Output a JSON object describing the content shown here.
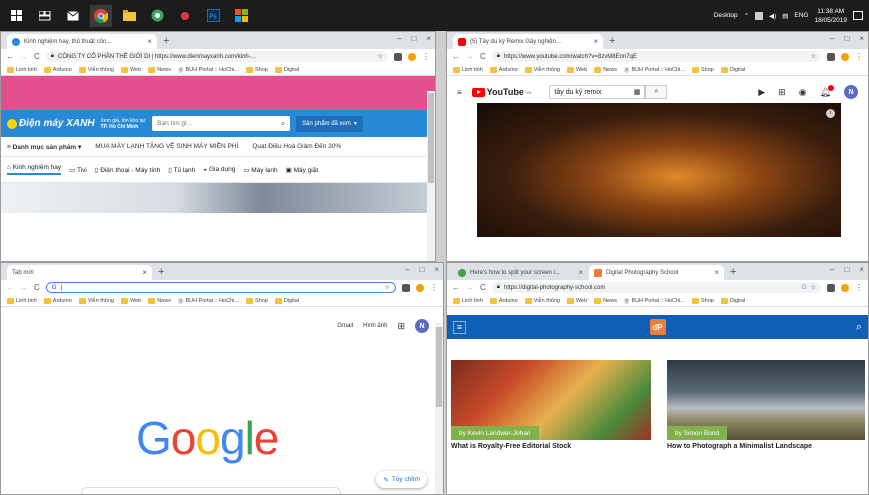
{
  "taskbar": {
    "icons": [
      "windows-logo-icon",
      "task-view-icon",
      "mail-icon",
      "chrome-icon",
      "file-explorer-icon",
      "green-app-icon",
      "red-app-icon",
      "photoshop-icon",
      "grid-app-icon"
    ],
    "desktop_label": "Desktop",
    "lang": "ENG",
    "time": "11:38 AM",
    "date": "18/05/2019"
  },
  "win1": {
    "tab_title": "Kinh nghiệm hay, thủ thuật côn...",
    "url": "CÔNG TY CỔ PHẦN THẾ GIỚI DI | https://www.dienmayxanh.com/kinh-...",
    "bookmarks": [
      "Linh tinh",
      "Arduino",
      "Viễn thông",
      "Web",
      "News",
      "BUH Portal :: HoChi...",
      "Shop",
      "Digital"
    ],
    "logo": "Điện máy XANH",
    "location_line1": "Xem giá, tồn kho tại:",
    "location_line2": "TP. Hồ Chí Minh",
    "search_placeholder": "Bạn tìm gì...",
    "cart_label": "Sản phẩm đã xem",
    "menu_label": "Danh mục sản phẩm",
    "promo1": "MUA MÁY LẠNH TẶNG VỆ SINH MÁY MIỄN PHÍ",
    "promo2": "Quạt Điều Hoà Giảm Đến 30%",
    "categories": [
      "Kinh nghiệm hay",
      "Tivi",
      "Điện thoại - Máy tính",
      "Tủ lạnh",
      "Gia dụng",
      "Máy lạnh",
      "Máy giặt"
    ]
  },
  "win2": {
    "tab_title": "(5) Tây du ký Remix Gây nghiện...",
    "url": "https://www.youtube.com/watch?v=8zvM8Enn7qE",
    "bookmarks": [
      "Linh tinh",
      "Arduino",
      "Viễn thông",
      "Web",
      "News",
      "BUH Portal :: HoChi...",
      "Shop",
      "Digital"
    ],
    "logo": "YouTube",
    "logo_region": "VN",
    "search_value": "tây du ký remix",
    "avatar": "N"
  },
  "win3": {
    "tab_title": "Tab mới",
    "url": "G",
    "bookmarks": [
      "Linh tinh",
      "Arduino",
      "Viễn thông",
      "Web",
      "News",
      "BUH Portal :: HoChi...",
      "Shop",
      "Digital"
    ],
    "gmail": "Gmail",
    "images": "Hình ảnh",
    "avatar": "N",
    "google_letters": [
      "G",
      "o",
      "o",
      "g",
      "l",
      "e"
    ],
    "google_colors": [
      "#4285f4",
      "#ea4335",
      "#fbbc05",
      "#4285f4",
      "#34a853",
      "#ea4335"
    ],
    "customize": "Tùy chỉnh"
  },
  "win4": {
    "tab1_title": "Here's how to split your screen i...",
    "tab2_title": "Digital Photography School",
    "url": "https://digital-photography-school.com",
    "bookmarks": [
      "Linh tinh",
      "Arduino",
      "Viễn thông",
      "Web",
      "News",
      "BUH Portal :: HoChi...",
      "Shop",
      "Digital"
    ],
    "logo_mark": "dP",
    "card1_author": "by Kevin Landwer-Johan",
    "card1_title": "What is Royalty-Free Editorial Stock",
    "card2_author": "by Simon Bond",
    "card2_title": "How to Photograph a Minimalist Landscape"
  }
}
